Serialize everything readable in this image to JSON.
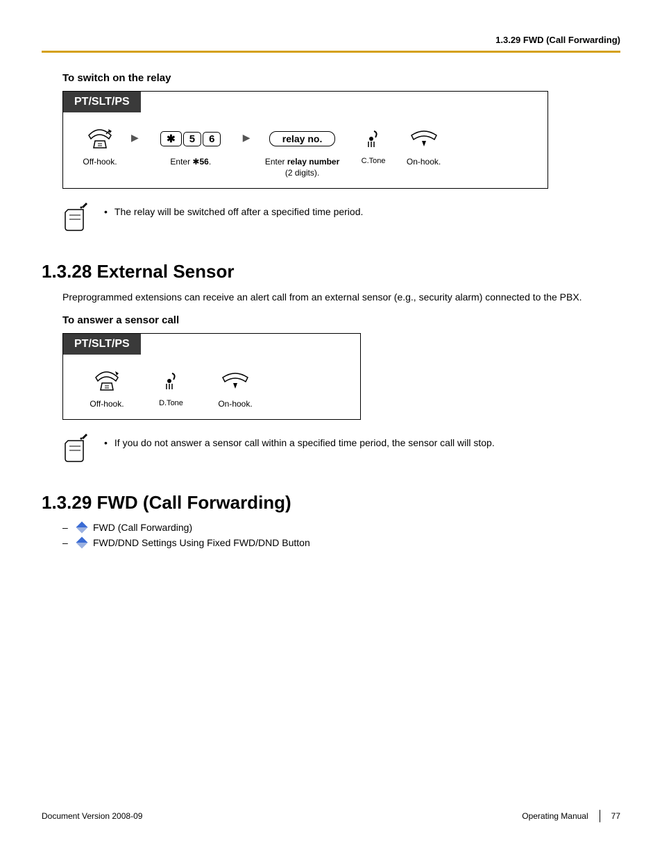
{
  "header": {
    "section_ref": "1.3.29 FWD (Call Forwarding)"
  },
  "relay": {
    "title": "To switch on the relay",
    "tab": "PT/SLT/PS",
    "steps": {
      "offhook": "Off-hook.",
      "keys": [
        "5",
        "6"
      ],
      "enter_label_prefix": "Enter ",
      "enter_label_code": "56",
      "enter_label_suffix": ".",
      "relay_field": "relay no.",
      "relay_instr_1": "Enter ",
      "relay_instr_bold": "relay number",
      "relay_instr_2": "(2 digits).",
      "ctone": "C.Tone",
      "onhook": "On-hook."
    },
    "note": "The relay will be switched off after a specified time period."
  },
  "s28": {
    "heading": "1.3.28  External Sensor",
    "body": "Preprogrammed extensions can receive an alert call from an external sensor (e.g., security alarm) connected to the PBX.",
    "sub_title": "To answer a sensor call",
    "tab": "PT/SLT/PS",
    "offhook": "Off-hook.",
    "dtone": "D.Tone",
    "onhook": "On-hook.",
    "note": "If you do not answer a sensor call within a specified time period, the sensor call will stop."
  },
  "s29": {
    "heading": "1.3.29  FWD (Call Forwarding)",
    "links": [
      "FWD (Call Forwarding)",
      "FWD/DND Settings Using Fixed FWD/DND Button"
    ]
  },
  "footer": {
    "left": "Document Version  2008-09",
    "manual": "Operating Manual",
    "page": "77"
  }
}
